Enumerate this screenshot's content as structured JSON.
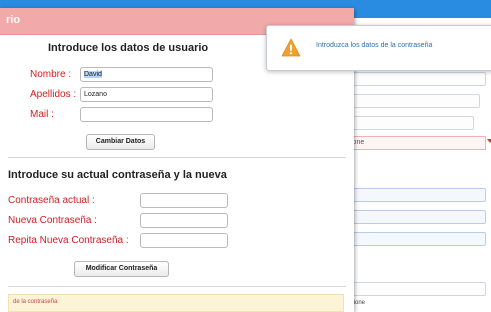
{
  "modal": {
    "title": "rio",
    "user_section": {
      "title": "Introduce los datos de usuario",
      "nombre_label": "Nombre :",
      "nombre_value": "David",
      "apellidos_label": "Apellidos :",
      "apellidos_value": "Lozano",
      "mail_label": "Mail :",
      "mail_value": "",
      "change_button": "Cambiar Datos"
    },
    "password_section": {
      "title": "Introduce su actual contraseña y la nueva",
      "current_label": "Contraseña actual :",
      "new_label": "Nueva Contraseña :",
      "repeat_label": "Repita Nueva Contraseña :",
      "modify_button": "Modificar Contraseña"
    },
    "info_bar_text": "de la contraseña"
  },
  "toast": {
    "message": "Introduzca los datos de la contraseña",
    "icon": "warning-icon"
  },
  "background": {
    "select_text": "ione",
    "bottom_text": "tione"
  },
  "colors": {
    "header": "#f1a9a9",
    "label_red": "#cc1f1f",
    "page_blue": "#2a8ce0",
    "warning": "#f0a030"
  }
}
